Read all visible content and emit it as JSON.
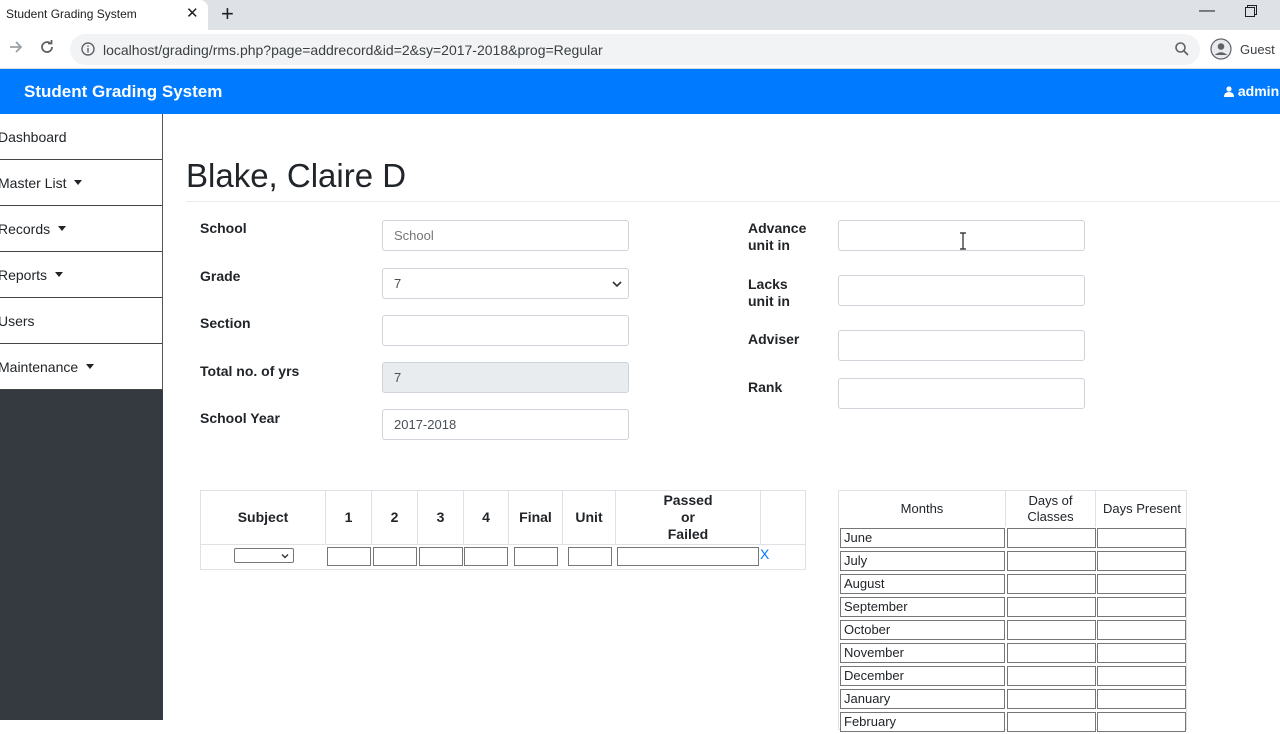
{
  "browser": {
    "tab_title": "Student Grading System",
    "url": "localhost/grading/rms.php?page=addrecord&id=2&sy=2017-2018&prog=Regular",
    "profile": "Guest"
  },
  "navbar": {
    "brand": "Student Grading System",
    "user": "admin"
  },
  "sidebar": {
    "items": [
      {
        "label": "Dashboard"
      },
      {
        "label": "Master List"
      },
      {
        "label": "Records"
      },
      {
        "label": "Reports"
      },
      {
        "label": "Users"
      },
      {
        "label": "Maintenance"
      }
    ]
  },
  "student": {
    "name": "Blake, Claire D"
  },
  "form": {
    "school_label": "School",
    "school_placeholder": "School",
    "grade_label": "Grade",
    "grade_value": "7",
    "section_label": "Section",
    "total_yrs_label": "Total no. of yrs",
    "total_yrs_value": "7",
    "school_year_label": "School Year",
    "school_year_value": "2017-2018",
    "advance_label_1": "Advance",
    "advance_label_2": "unit in",
    "lacks_label_1": "Lacks",
    "lacks_label_2": "unit in",
    "adviser_label": "Adviser",
    "rank_label": "Rank"
  },
  "grades_table": {
    "headers": {
      "subject": "Subject",
      "q1": "1",
      "q2": "2",
      "q3": "3",
      "q4": "4",
      "final": "Final",
      "unit": "Unit",
      "passed_1": "Passed",
      "passed_2": "or",
      "passed_3": "Failed"
    },
    "remove": "X"
  },
  "attendance": {
    "headers": {
      "months": "Months",
      "days_classes_1": "Days of",
      "days_classes_2": "Classes",
      "days_present": "Days Present"
    },
    "months": [
      "June",
      "July",
      "August",
      "September",
      "October",
      "November",
      "December",
      "January",
      "February"
    ]
  }
}
